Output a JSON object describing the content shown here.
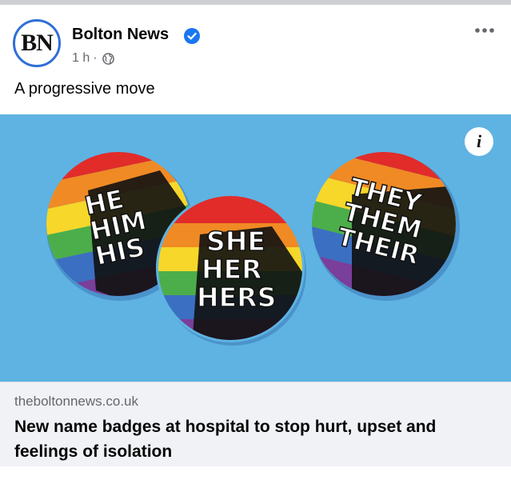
{
  "post": {
    "avatar_initials": "BN",
    "page_name": "Bolton News",
    "time": "1 h",
    "meta_separator": "·",
    "text": "A progressive move"
  },
  "link_card": {
    "domain": "theboltonnews.co.uk",
    "title": "New name badges at hospital to stop hurt, upset and feelings of isolation",
    "info_label": "i",
    "badges": [
      {
        "lines": [
          "HE",
          "HIM",
          "HIS"
        ]
      },
      {
        "lines": [
          "SHE",
          "HER",
          "HERS"
        ]
      },
      {
        "lines": [
          "THEY",
          "THEM",
          "THEIR"
        ]
      }
    ]
  },
  "icons": {
    "verified": "verified-badge-icon",
    "audience": "globe-icon",
    "more": "more-horizontal-icon"
  },
  "colors": {
    "verified_blue": "#1877f2",
    "image_background": "#5eb3e2",
    "footer_background": "#f0f2f5",
    "muted_text": "#65676b"
  }
}
